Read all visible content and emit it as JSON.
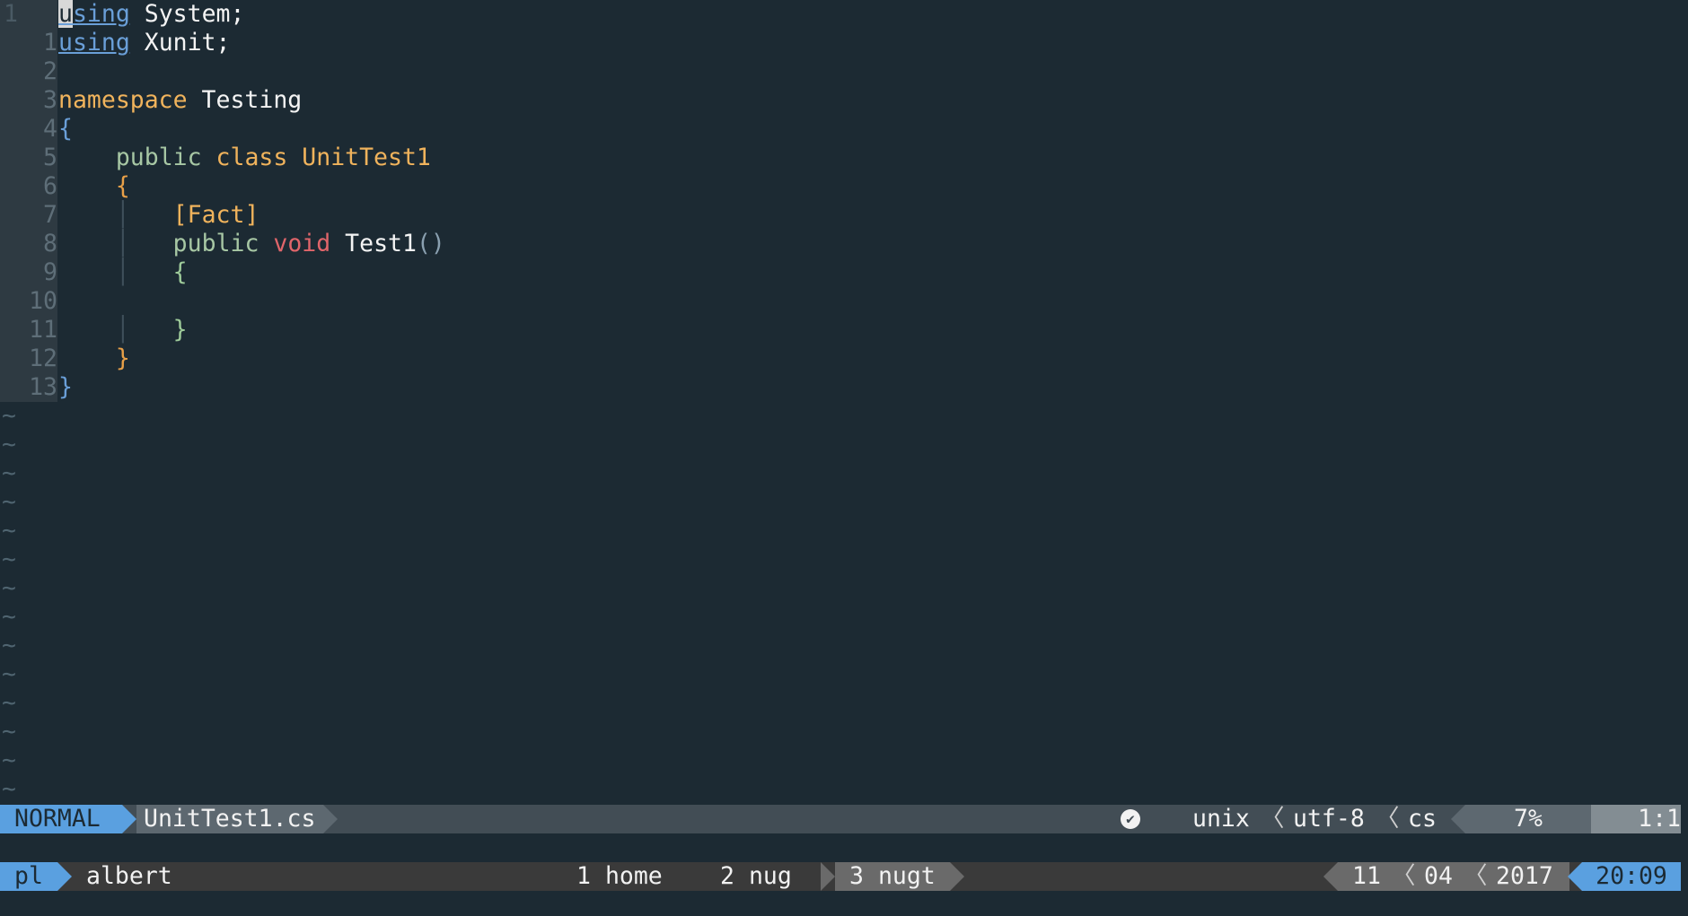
{
  "editor": {
    "gutter_numbers": [
      "1",
      "1",
      "2",
      "3",
      "4",
      "5",
      "6",
      "7",
      "8",
      "9",
      "10",
      "11",
      "12",
      "13"
    ],
    "lines": {
      "l0_kw": "using",
      "l0_rest": " System;",
      "l1_kw": "using",
      "l1_rest": " Xunit;",
      "l3_kw": "namespace",
      "l3_rest": " Testing",
      "l4": "{",
      "l5_pub": "public",
      "l5_class": "class",
      "l5_name": "UnitTest1",
      "l6": "{",
      "l7": "[Fact]",
      "l8_pub": "public",
      "l8_void": "void",
      "l8_name": "Test1",
      "l8_paren": "()",
      "l9": "{",
      "l11": "}",
      "l12": "}",
      "l13": "}"
    },
    "tilde": "~",
    "guide": "│"
  },
  "statusline": {
    "mode": "NORMAL",
    "filename": "UnitTest1.cs",
    "fileformat": "unix",
    "encoding": "utf-8",
    "filetype": "cs",
    "percent": "7%",
    "position": "1:1",
    "separator": "〈"
  },
  "tmux": {
    "session": "pl",
    "user": "albert",
    "windows": [
      {
        "index": "1",
        "name": "home"
      },
      {
        "index": "2",
        "name": "nug"
      },
      {
        "index": "3",
        "name": "nugt"
      }
    ],
    "date_day": "11",
    "date_month": "04",
    "date_year": "2017",
    "time": "20:09"
  },
  "colors": {
    "background": "#1c2a33",
    "mode_accent": "#5aa0e0"
  }
}
